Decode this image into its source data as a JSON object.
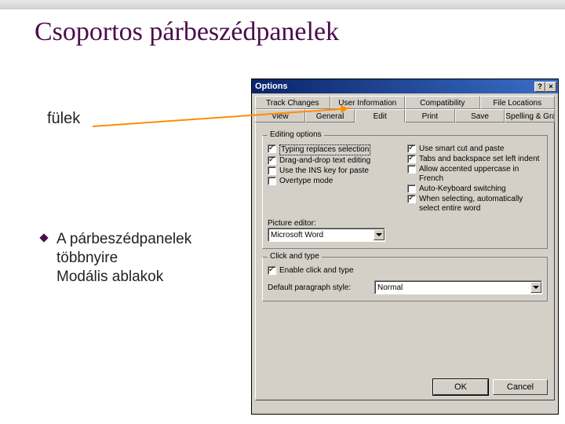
{
  "slide": {
    "title": "Csoportos párbeszédpanelek",
    "fulek_label": "fülek",
    "bullet1_line1": "A párbeszédpanelek",
    "bullet1_line2": " többnyire",
    "bullet1_line3": "Modális ablakok"
  },
  "dialog": {
    "title": "Options",
    "help_btn": "?",
    "close_btn": "×",
    "tabs_row1": [
      "Track Changes",
      "User Information",
      "Compatibility",
      "File Locations"
    ],
    "tabs_row2": [
      "View",
      "General",
      "Edit",
      "Print",
      "Save",
      "Spelling & Grammar"
    ],
    "group_editing": "Editing options",
    "opts_left": [
      {
        "label": "Typing replaces selection",
        "checked": true,
        "sel": true
      },
      {
        "label": "Drag-and-drop text editing",
        "checked": true
      },
      {
        "label": "Use the INS key for paste",
        "checked": false
      },
      {
        "label": "Overtype mode",
        "checked": false
      }
    ],
    "opts_right": [
      {
        "label": "Use smart cut and paste",
        "checked": true
      },
      {
        "label": "Tabs and backspace set left indent",
        "checked": true
      },
      {
        "label": "Allow accented uppercase in French",
        "checked": false
      },
      {
        "label": "Auto-Keyboard switching",
        "checked": false
      },
      {
        "label": "When selecting, automatically select entire word",
        "checked": true
      }
    ],
    "picture_editor_label": "Picture editor:",
    "picture_editor_value": "Microsoft Word",
    "group_click": "Click and type",
    "enable_click": {
      "label": "Enable click and type",
      "checked": true
    },
    "default_para_label": "Default paragraph style:",
    "default_para_value": "Normal",
    "ok": "OK",
    "cancel": "Cancel"
  }
}
